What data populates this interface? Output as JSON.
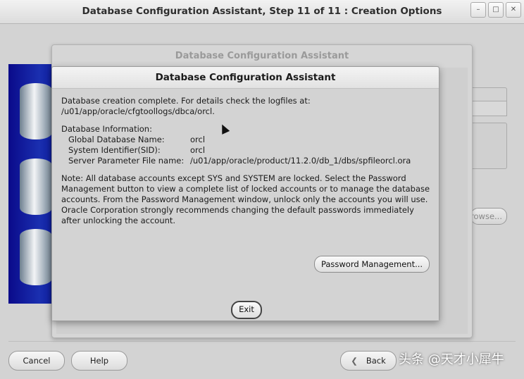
{
  "window": {
    "title": "Database Configuration Assistant, Step 11 of 11 : Creation Options",
    "min_icon": "–",
    "max_icon": "□",
    "close_icon": "✕"
  },
  "outer_dialog": {
    "title": "Database Configuration Assistant"
  },
  "dialog": {
    "title": "Database Configuration Assistant",
    "message_line1": "Database creation complete. For details check the logfiles at:",
    "message_line2": " /u01/app/oracle/cfgtoollogs/dbca/orcl.",
    "info_heading": "Database Information:",
    "fields": [
      {
        "label": "Global Database Name:",
        "value": "orcl"
      },
      {
        "label": "System Identifier(SID):",
        "value": "orcl"
      },
      {
        "label": "Server Parameter File name:",
        "value": "/u01/app/oracle/product/11.2.0/db_1/dbs/spfileorcl.ora"
      }
    ],
    "note_lines": [
      "Note: All database accounts except SYS and SYSTEM are locked. Select the Password",
      "Management button to view a complete list of locked accounts or to manage the database",
      "accounts. From the Password Management window, unlock only the accounts you will use.",
      "Oracle Corporation strongly recommends changing the default passwords immediately",
      "after unlocking the account."
    ],
    "password_button": "Password Management...",
    "exit_button": "Exit"
  },
  "wizard": {
    "browse_button": "Browse...",
    "cancel_button": "Cancel",
    "help_button": "Help",
    "back_button": "Back",
    "back_icon": "❮"
  },
  "watermark": "头条 @天才小犀牛"
}
